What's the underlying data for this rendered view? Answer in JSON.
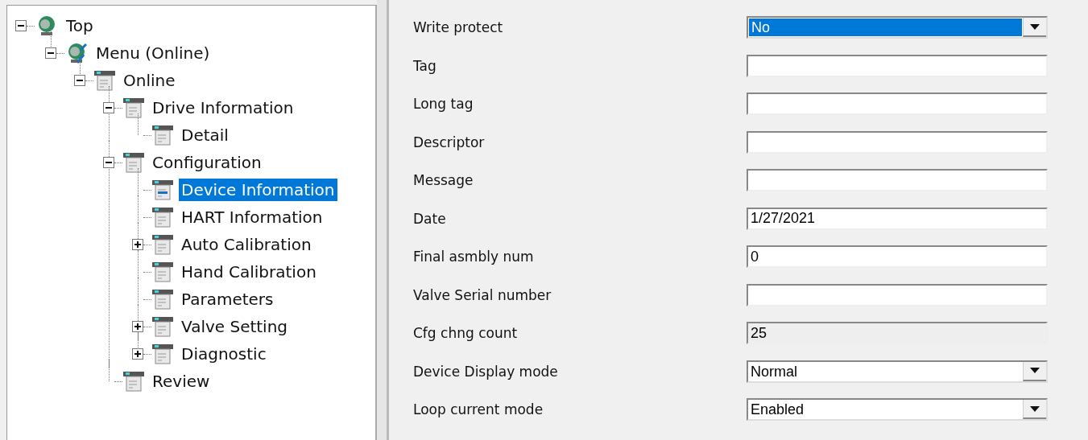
{
  "tree": [
    {
      "label": "Top",
      "kind": "device",
      "expanded": true,
      "selected": false,
      "children": [
        {
          "label": "Menu (Online)",
          "kind": "device-tool",
          "expanded": true,
          "selected": false,
          "children": [
            {
              "label": "Online",
              "kind": "page",
              "expanded": true,
              "selected": false,
              "children": [
                {
                  "label": "Drive Information",
                  "kind": "page",
                  "expanded": true,
                  "selected": false,
                  "children": [
                    {
                      "label": "Detail",
                      "kind": "page",
                      "selected": false
                    }
                  ]
                },
                {
                  "label": "Configuration",
                  "kind": "page",
                  "expanded": true,
                  "selected": false,
                  "children": [
                    {
                      "label": "Device Information",
                      "kind": "page",
                      "selected": true
                    },
                    {
                      "label": "HART Information",
                      "kind": "page",
                      "selected": false
                    },
                    {
                      "label": "Auto Calibration",
                      "kind": "page",
                      "expanded": false,
                      "selected": false
                    },
                    {
                      "label": "Hand Calibration",
                      "kind": "page",
                      "selected": false
                    },
                    {
                      "label": "Parameters",
                      "kind": "page",
                      "selected": false
                    },
                    {
                      "label": "Valve Setting",
                      "kind": "page",
                      "expanded": false,
                      "selected": false
                    },
                    {
                      "label": "Diagnostic",
                      "kind": "page",
                      "expanded": false,
                      "selected": false
                    }
                  ]
                },
                {
                  "label": "Review",
                  "kind": "page",
                  "selected": false
                }
              ]
            }
          ]
        }
      ]
    }
  ],
  "fields": [
    {
      "label": "Write protect",
      "kind": "dropdown",
      "value": "No",
      "focused": true
    },
    {
      "label": "Tag",
      "kind": "text",
      "disabled": false
    },
    {
      "label": "Long tag",
      "kind": "text",
      "disabled": false
    },
    {
      "label": "Descriptor",
      "kind": "text",
      "disabled": false
    },
    {
      "label": "Message",
      "kind": "text",
      "disabled": false
    },
    {
      "label": "Date",
      "kind": "text",
      "value": "1/27/2021",
      "disabled": false
    },
    {
      "label": "Final asmbly num",
      "kind": "text",
      "value": "0",
      "disabled": false
    },
    {
      "label": "Valve Serial number",
      "kind": "text",
      "disabled": false
    },
    {
      "label": "Cfg chng count",
      "kind": "text",
      "value": "25",
      "disabled": true
    },
    {
      "label": "Device Display mode",
      "kind": "dropdown",
      "value": "Normal",
      "focused": false
    },
    {
      "label": "Loop current mode",
      "kind": "dropdown",
      "value": "Enabled",
      "focused": false
    }
  ]
}
